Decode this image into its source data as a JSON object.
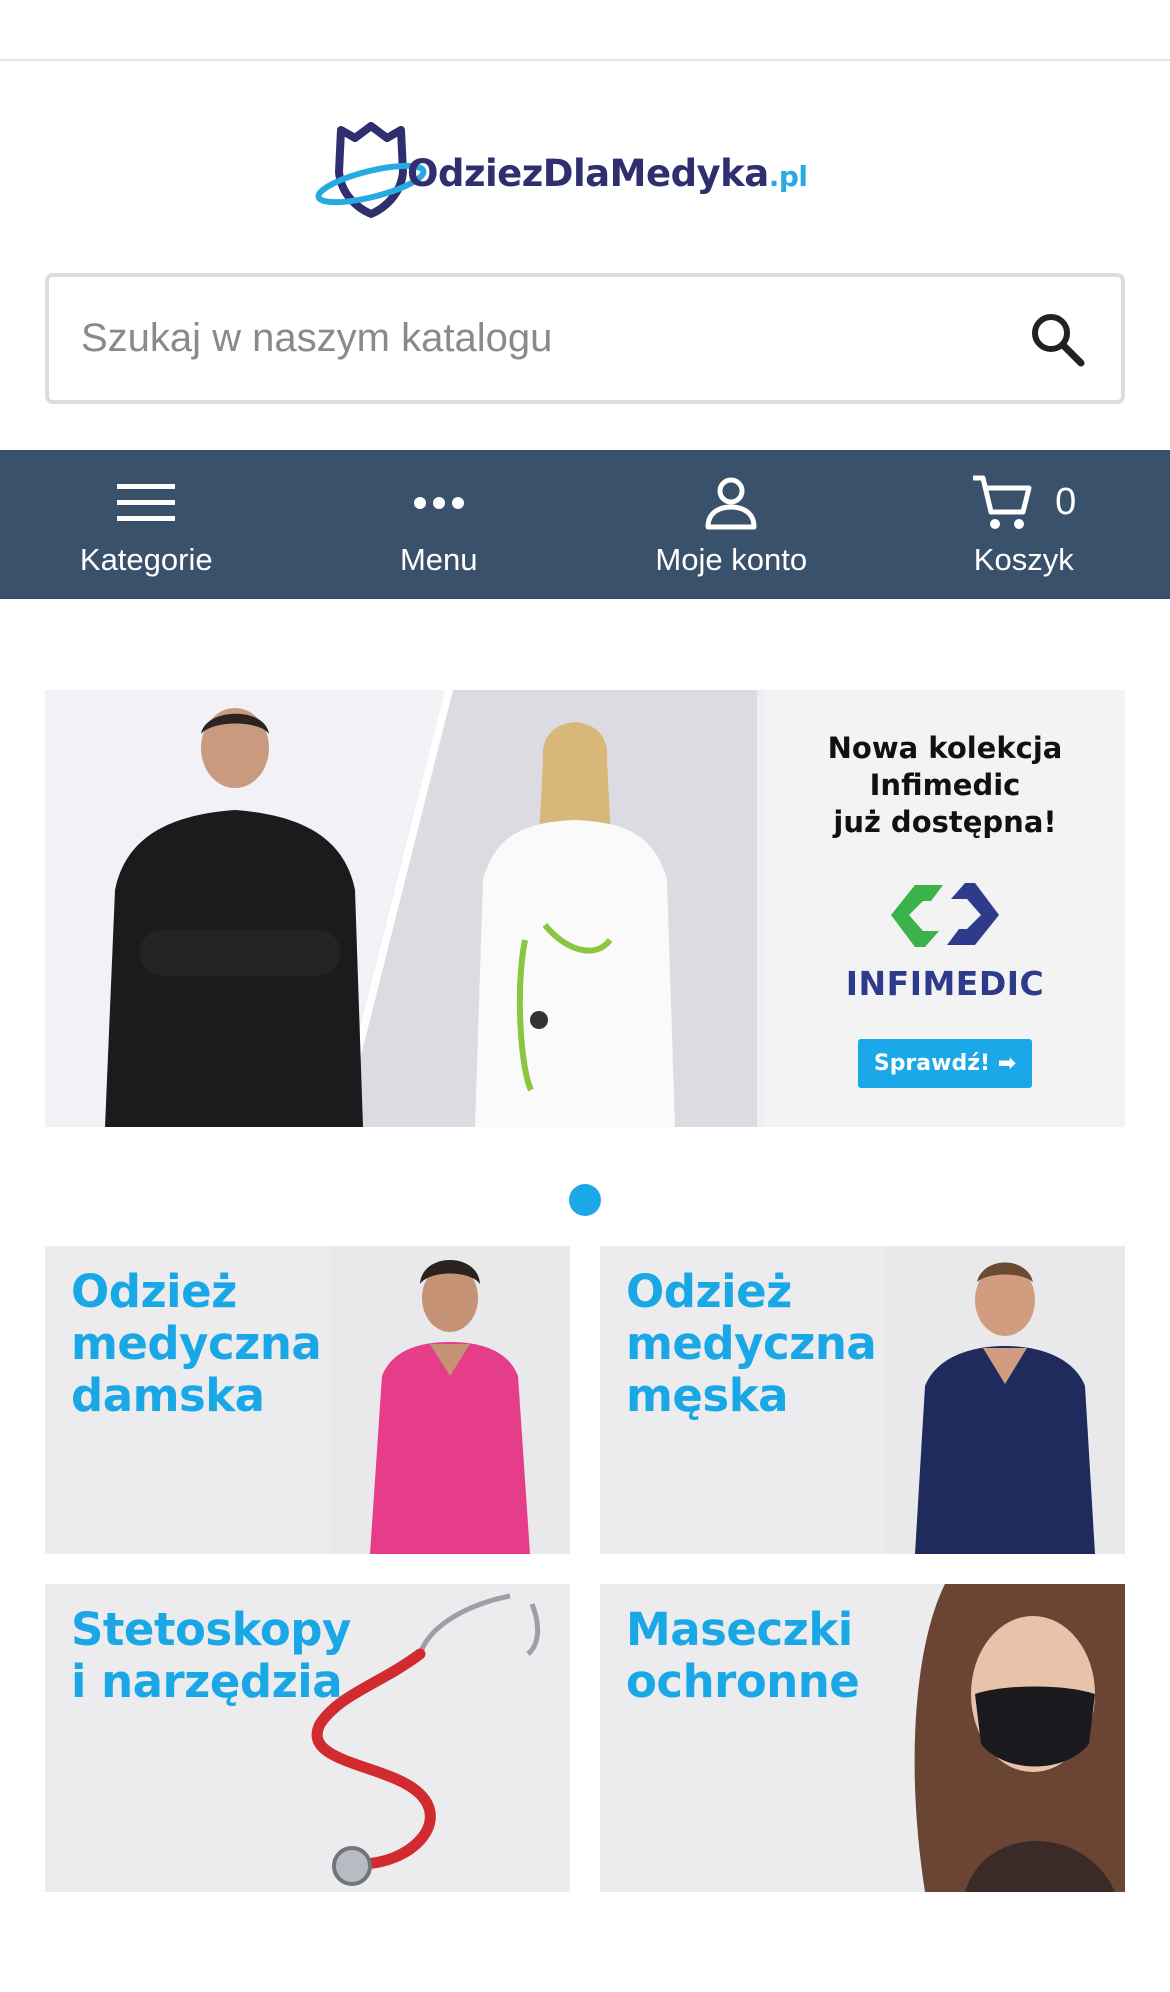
{
  "logo": {
    "name": "OdziezDlaMedyka",
    "tld": ".pl"
  },
  "search": {
    "placeholder": "Szukaj w naszym katalogu"
  },
  "nav": {
    "items": [
      {
        "label": "Kategorie",
        "icon": "hamburger-icon"
      },
      {
        "label": "Menu",
        "icon": "more-dots-icon"
      },
      {
        "label": "Moje konto",
        "icon": "user-icon"
      },
      {
        "label": "Koszyk",
        "icon": "cart-icon"
      }
    ],
    "cart_count": "0"
  },
  "slider": {
    "promo": {
      "line1": "Nowa kolekcja",
      "line2": "Infimedic",
      "line3": "już dostępna!",
      "brand": "INFIMEDIC",
      "button": "Sprawdź! ➡"
    },
    "active_dot": 1,
    "dot_count": 1
  },
  "categories": [
    {
      "lines": [
        "Odzież",
        "medyczna",
        "damska"
      ]
    },
    {
      "lines": [
        "Odzież",
        "medyczna",
        "męska"
      ]
    },
    {
      "lines": [
        "Stetoskopy",
        "i narzędzia"
      ]
    },
    {
      "lines": [
        "Maseczki",
        "ochronne"
      ]
    }
  ],
  "colors": {
    "navbar": "#3a516b",
    "accent": "#1aa8e8",
    "logo_dark": "#2f2e6e"
  }
}
